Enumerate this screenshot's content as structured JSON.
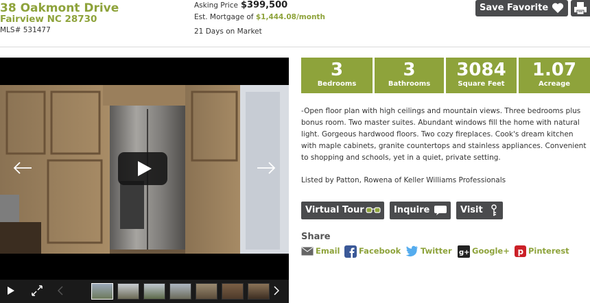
{
  "listing": {
    "address": "38 Oakmont Drive",
    "city": "Fairview NC 28730",
    "mls": "MLS# 531477",
    "price_label": "Asking Price",
    "price": "$399,500",
    "mortgage_label": "Est. Mortgage of",
    "mortgage": "$1,444.08/month",
    "days_on_market": "21 Days on Market"
  },
  "header": {
    "save_label": "Save Favorite",
    "print_icon": "print-icon"
  },
  "video": {
    "thumb_count": 7
  },
  "stats": [
    {
      "value": "3",
      "label": "Bedrooms"
    },
    {
      "value": "3",
      "label": "Bathrooms"
    },
    {
      "value": "3084",
      "label": "Square Feet"
    },
    {
      "value": "1.07",
      "label": "Acreage"
    }
  ],
  "description": "-Open floor plan with high ceilings and mountain views. Three bedrooms plus bonus room. Two master suites. Abundant windows fill the home with natural light. Gorgeous hardwood floors. Two cozy fireplaces. Cook's dream kitchen with maple cabinets, granite countertops and stainless appliances. Convenient to shopping and schools, yet in a quiet, private setting.",
  "listed_by": "Listed by Patton, Rowena of Keller Williams Professionals",
  "actions": {
    "virtual_tour": "Virtual Tour",
    "inquire": "Inquire",
    "visit": "Visit"
  },
  "share": {
    "heading": "Share",
    "items": [
      {
        "label": "Email",
        "icon": "envelope-icon"
      },
      {
        "label": "Facebook",
        "icon": "facebook-icon"
      },
      {
        "label": "Twitter",
        "icon": "twitter-icon"
      },
      {
        "label": "Google+",
        "icon": "google-plus-icon"
      },
      {
        "label": "Pinterest",
        "icon": "pinterest-icon"
      }
    ]
  },
  "colors": {
    "accent": "#8ea33b",
    "button_dark": "#4a4b4d"
  }
}
